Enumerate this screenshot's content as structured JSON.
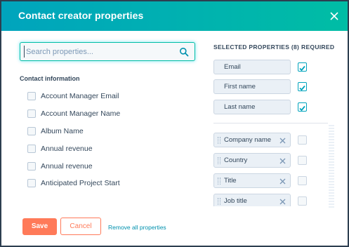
{
  "dialog": {
    "title": "Contact creator properties",
    "close_icon": "close-icon"
  },
  "search": {
    "placeholder": "Search properties...",
    "value": "",
    "icon": "search-icon"
  },
  "group": {
    "label": "Contact information",
    "items": [
      {
        "label": "Account Manager Email",
        "checked": false
      },
      {
        "label": "Account Manager Name",
        "checked": false
      },
      {
        "label": "Album Name",
        "checked": false
      },
      {
        "label": "Annual revenue",
        "checked": false
      },
      {
        "label": "Annual revenue",
        "checked": false
      },
      {
        "label": "Anticipated Project Start",
        "checked": false
      }
    ]
  },
  "selected": {
    "header": "SELECTED PROPERTIES (8)",
    "required_header": "REQUIRED",
    "fixed": [
      {
        "label": "Email",
        "required": true
      },
      {
        "label": "First name",
        "required": true
      },
      {
        "label": "Last name",
        "required": true
      }
    ],
    "removable": [
      {
        "label": "Company name",
        "required": false
      },
      {
        "label": "Country",
        "required": false
      },
      {
        "label": "Title",
        "required": false
      },
      {
        "label": "Job title",
        "required": false
      }
    ]
  },
  "footer": {
    "save_label": "Save",
    "cancel_label": "Cancel",
    "remove_all_label": "Remove all properties"
  },
  "colors": {
    "header_start": "#00a4bd",
    "header_end": "#00bda5",
    "primary": "#ff7a59",
    "link": "#0091ae",
    "check": "#00a4bd"
  }
}
